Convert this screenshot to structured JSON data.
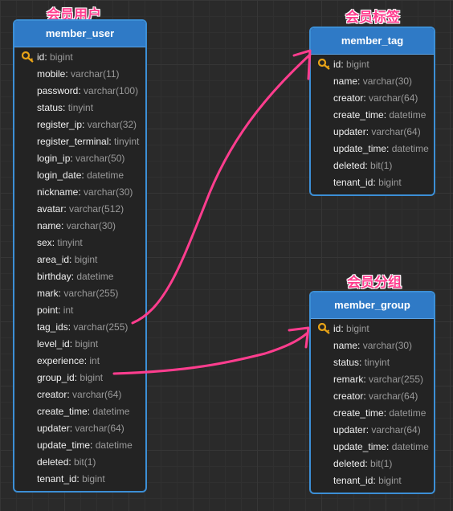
{
  "captions": {
    "member_user": "会员用户",
    "member_tag": "会员标签",
    "member_group": "会员分组"
  },
  "tables": {
    "member_user": {
      "title": "member_user",
      "fields": [
        {
          "name": "id",
          "type": "bigint",
          "key": true
        },
        {
          "name": "mobile",
          "type": "varchar(11)"
        },
        {
          "name": "password",
          "type": "varchar(100)"
        },
        {
          "name": "status",
          "type": "tinyint"
        },
        {
          "name": "register_ip",
          "type": "varchar(32)"
        },
        {
          "name": "register_terminal",
          "type": "tinyint"
        },
        {
          "name": "login_ip",
          "type": "varchar(50)"
        },
        {
          "name": "login_date",
          "type": "datetime"
        },
        {
          "name": "nickname",
          "type": "varchar(30)"
        },
        {
          "name": "avatar",
          "type": "varchar(512)"
        },
        {
          "name": "name",
          "type": "varchar(30)"
        },
        {
          "name": "sex",
          "type": "tinyint"
        },
        {
          "name": "area_id",
          "type": "bigint"
        },
        {
          "name": "birthday",
          "type": "datetime"
        },
        {
          "name": "mark",
          "type": "varchar(255)"
        },
        {
          "name": "point",
          "type": "int"
        },
        {
          "name": "tag_ids",
          "type": "varchar(255)"
        },
        {
          "name": "level_id",
          "type": "bigint"
        },
        {
          "name": "experience",
          "type": "int"
        },
        {
          "name": "group_id",
          "type": "bigint"
        },
        {
          "name": "creator",
          "type": "varchar(64)"
        },
        {
          "name": "create_time",
          "type": "datetime"
        },
        {
          "name": "updater",
          "type": "varchar(64)"
        },
        {
          "name": "update_time",
          "type": "datetime"
        },
        {
          "name": "deleted",
          "type": "bit(1)"
        },
        {
          "name": "tenant_id",
          "type": "bigint"
        }
      ]
    },
    "member_tag": {
      "title": "member_tag",
      "fields": [
        {
          "name": "id",
          "type": "bigint",
          "key": true
        },
        {
          "name": "name",
          "type": "varchar(30)"
        },
        {
          "name": "creator",
          "type": "varchar(64)"
        },
        {
          "name": "create_time",
          "type": "datetime"
        },
        {
          "name": "updater",
          "type": "varchar(64)"
        },
        {
          "name": "update_time",
          "type": "datetime"
        },
        {
          "name": "deleted",
          "type": "bit(1)"
        },
        {
          "name": "tenant_id",
          "type": "bigint"
        }
      ]
    },
    "member_group": {
      "title": "member_group",
      "fields": [
        {
          "name": "id",
          "type": "bigint",
          "key": true
        },
        {
          "name": "name",
          "type": "varchar(30)"
        },
        {
          "name": "status",
          "type": "tinyint"
        },
        {
          "name": "remark",
          "type": "varchar(255)"
        },
        {
          "name": "creator",
          "type": "varchar(64)"
        },
        {
          "name": "create_time",
          "type": "datetime"
        },
        {
          "name": "updater",
          "type": "varchar(64)"
        },
        {
          "name": "update_time",
          "type": "datetime"
        },
        {
          "name": "deleted",
          "type": "bit(1)"
        },
        {
          "name": "tenant_id",
          "type": "bigint"
        }
      ]
    }
  },
  "relations": [
    {
      "from_table": "member_user",
      "from_field": "tag_ids",
      "to_table": "member_tag",
      "to_field": "id"
    },
    {
      "from_table": "member_user",
      "from_field": "group_id",
      "to_table": "member_group",
      "to_field": "id"
    }
  ],
  "colors": {
    "header": "#2f7ac6",
    "border": "#3c8fd6",
    "annotation": "#ff3d8e",
    "key": "#e8a317"
  }
}
